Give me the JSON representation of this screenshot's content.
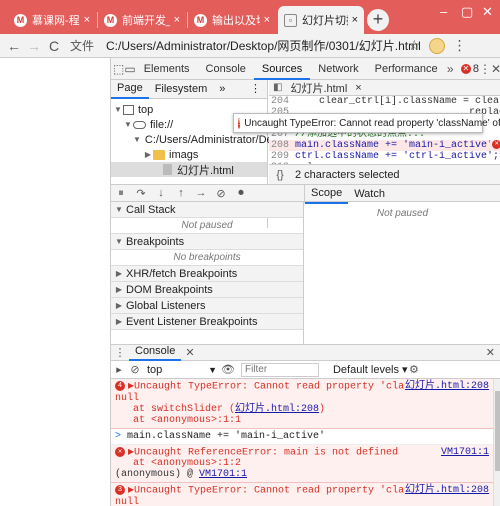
{
  "browser": {
    "tabs": [
      {
        "label": "慕课网-程序",
        "favicon": "M"
      },
      {
        "label": "前端开发_人",
        "favicon": "M"
      },
      {
        "label": "输出以及切",
        "favicon": "M"
      },
      {
        "label": "幻灯片切换",
        "favicon": "▫"
      }
    ],
    "tab_close": "×",
    "new_tab": "+",
    "window_minimize": "–",
    "window_maximize": "▢",
    "window_close": "✕",
    "tab_strip_color": "#e35d5b"
  },
  "address_bar": {
    "back": "←",
    "forward": "→",
    "reload": "C",
    "scheme_label": "文件",
    "url": "C:/Users/Administrator/Desktop/网页制作/0301/幻灯片.html",
    "star": "☆",
    "menu": "⋮"
  },
  "devtools": {
    "inspect_icon": "⬚",
    "device_icon": "▭",
    "tabs": [
      "Elements",
      "Console",
      "Sources",
      "Network",
      "Performance"
    ],
    "more_tabs": "»",
    "error_count": "8",
    "settings_icon": "⋮",
    "close_icon": "✕",
    "navigator": {
      "tabs": [
        "Page",
        "Filesystem"
      ],
      "more": "»",
      "menu": "⋮",
      "tree": [
        {
          "label": "top",
          "tri": "▼"
        },
        {
          "label": "file://",
          "tri": "▼"
        },
        {
          "label": "C:/Users/Administrator/Deskto",
          "tri": "▼"
        },
        {
          "label": "imags",
          "tri": "▶"
        },
        {
          "label": "幻灯片.html",
          "tri": ""
        }
      ]
    },
    "editor": {
      "file_tab": "幻灯片.html",
      "file_close": "×",
      "lines": [
        {
          "num": "204",
          "text": "    clear_ctrl[i].className = clear_ctrl["
        },
        {
          "num": "205",
          "text": "                             replace('ctr"
        },
        {
          "num": "206",
          "text": "  }"
        },
        {
          "num": "207",
          "text": "//添加选中的状态的焦点..."
        },
        {
          "num": "208",
          "text": "main.className += 'main-i_active';"
        },
        {
          "num": "209",
          "text": "ctrl.className += 'ctrl-i_active';"
        },
        {
          "num": "210",
          "text": "  }"
        }
      ],
      "tooltip": "Uncaught TypeError: Cannot read property 'className' of null",
      "status": "2 characters selected",
      "status_icon": "{}"
    },
    "debugger": {
      "controls": [
        "⏸",
        "↷",
        "↓",
        "↑",
        "→",
        "⊘",
        "⏺"
      ],
      "scope_tabs": [
        "Scope",
        "Watch"
      ],
      "scope_empty": "Not paused",
      "sections": [
        {
          "title": "Call Stack",
          "open": true,
          "body": "Not paused"
        },
        {
          "title": "Breakpoints",
          "open": true,
          "body": "No breakpoints"
        },
        {
          "title": "XHR/fetch Breakpoints",
          "open": false
        },
        {
          "title": "DOM Breakpoints",
          "open": false
        },
        {
          "title": "Global Listeners",
          "open": false
        },
        {
          "title": "Event Listener Breakpoints",
          "open": false
        }
      ]
    },
    "console": {
      "drawer_tab": "Console",
      "drawer_menu": "⋮",
      "drawer_close": "✕",
      "context": "top",
      "filter_placeholder": "Filter",
      "levels": "Default levels ▾",
      "settings": "⚙",
      "messages": [
        {
          "type": "error",
          "badge": "4",
          "text": "▶Uncaught TypeError: Cannot read property 'className' of null",
          "location": "幻灯片.html:208",
          "stack": [
            "at switchSlider (幻灯片.html:208)",
            "at <anonymous>:1:1"
          ]
        },
        {
          "type": "input",
          "prompt": ">",
          "text": "main.className += 'main-i_active'"
        },
        {
          "type": "error",
          "badge": "✕",
          "text": "▶Uncaught ReferenceError: main is not defined",
          "location": "VM1701:1",
          "stack": [
            "at <anonymous>:1:2"
          ],
          "tail": "(anonymous) @ ",
          "tail_link": "VM1701:1"
        },
        {
          "type": "error",
          "badge": "3",
          "text": "▶Uncaught TypeError: Cannot read property 'className' of null",
          "location": "幻灯片.html:208",
          "stack": []
        }
      ]
    }
  }
}
